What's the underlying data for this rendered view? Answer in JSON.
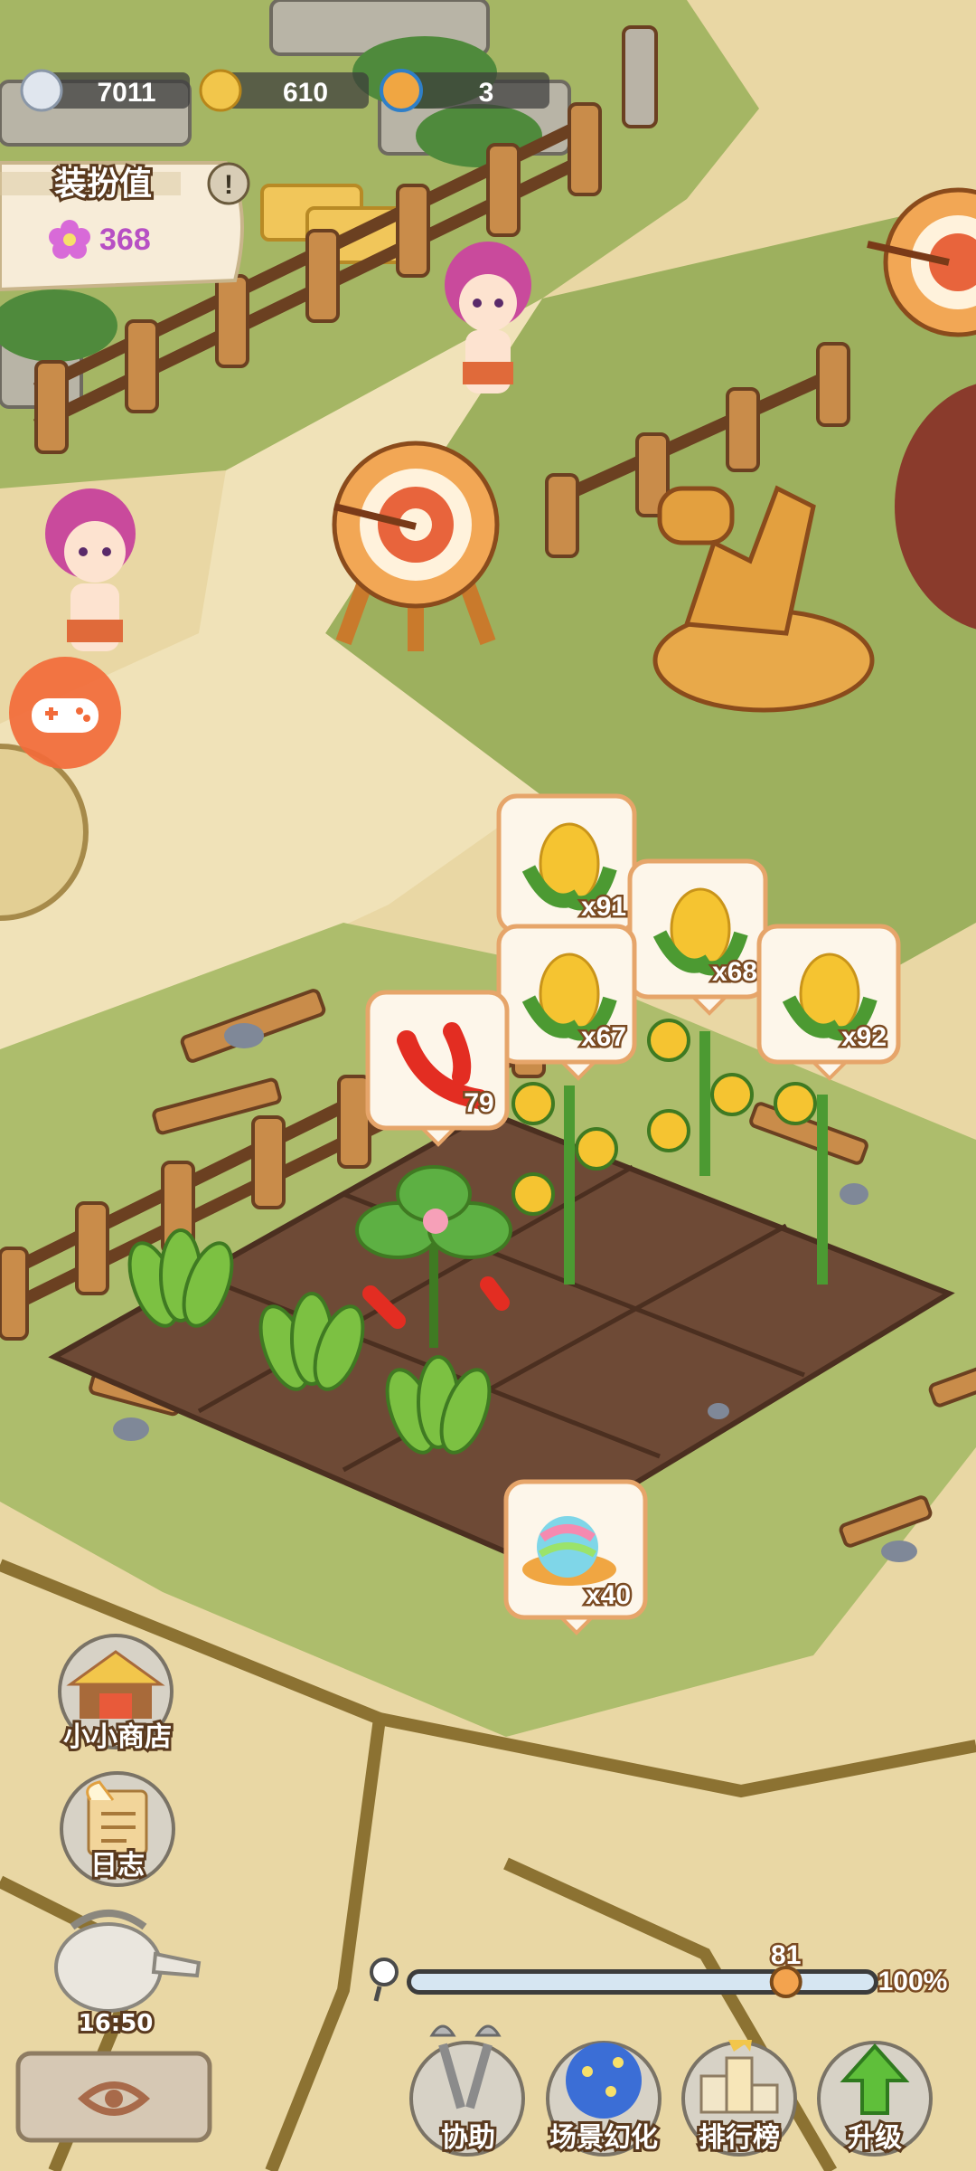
{
  "resources": [
    {
      "icon": "feather-icon",
      "value": "7011"
    },
    {
      "icon": "gold-coin-icon",
      "value": "610"
    },
    {
      "icon": "fish-icon",
      "value": "3"
    }
  ],
  "charm": {
    "label": "装扮值",
    "value": "368",
    "info": "!"
  },
  "bubbles": {
    "b1": "x91",
    "b2": "x68",
    "b3": "x67",
    "b4": "x92",
    "b5": "79",
    "b6": "x40"
  },
  "side_menu": {
    "shop": "小小商店",
    "log": "日志",
    "timer": "16:50"
  },
  "zoom": {
    "value": "81",
    "max_label": "100%",
    "level": 0.81
  },
  "bottom_menu": {
    "assist": "协助",
    "scene": "场景幻化",
    "rank": "排行榜",
    "upgrade": "升级"
  }
}
